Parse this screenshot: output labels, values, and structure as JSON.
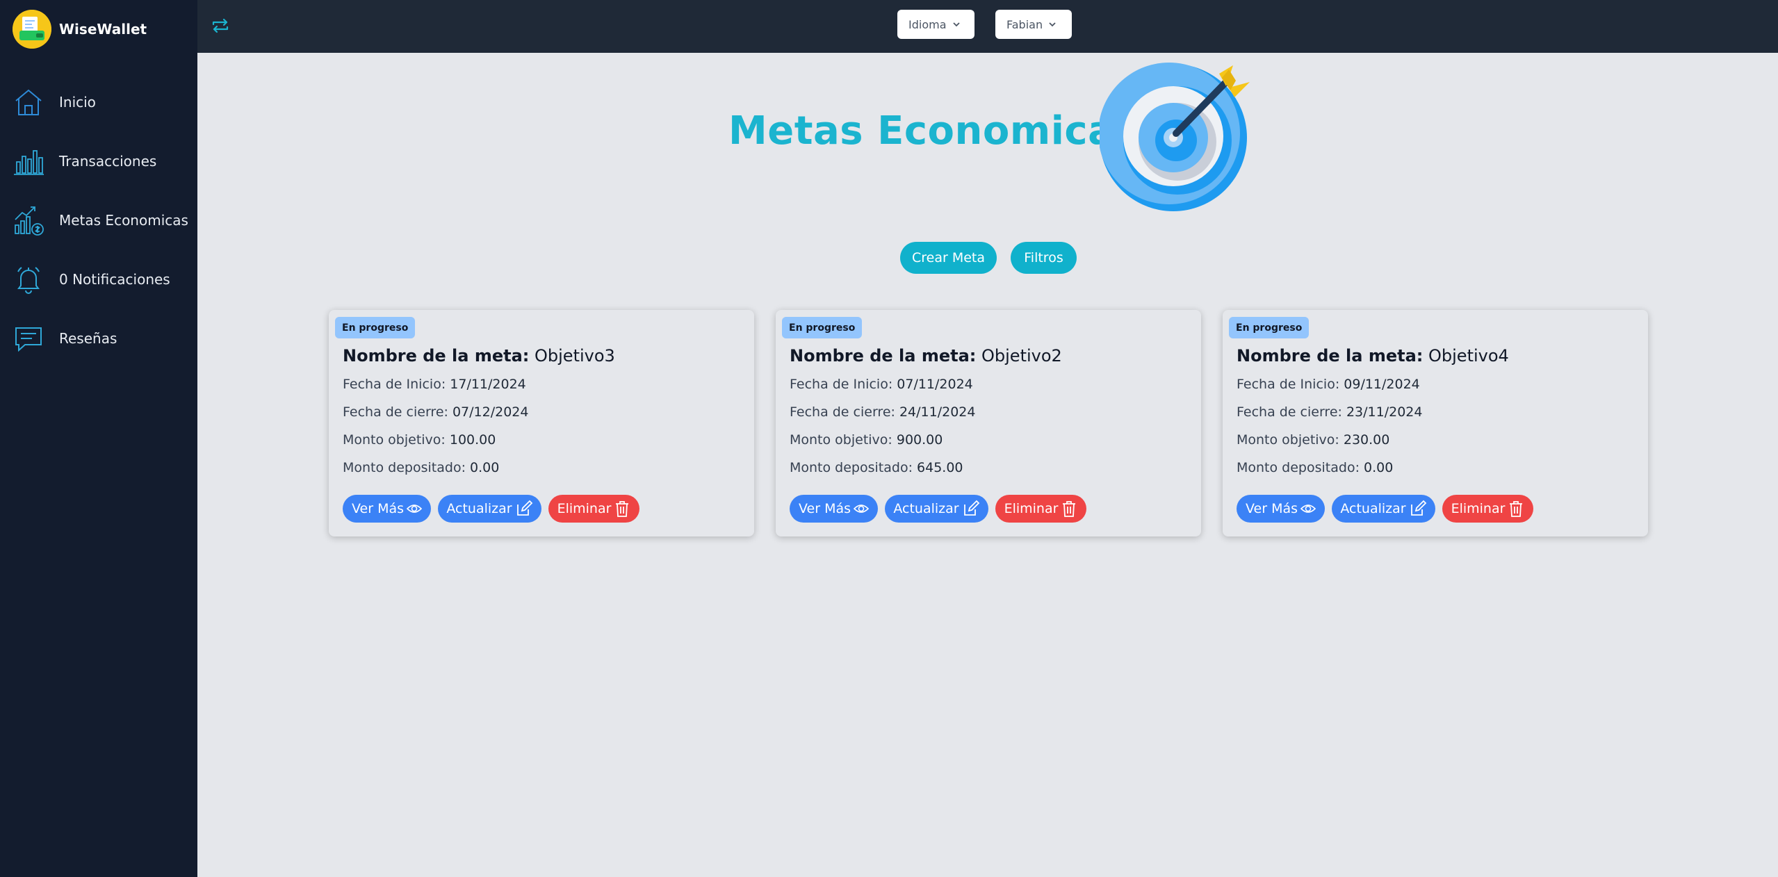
{
  "brand": {
    "name": "WiseWallet"
  },
  "sidebar": {
    "items": [
      {
        "label": "Inicio",
        "icon": "home-icon"
      },
      {
        "label": "Transacciones",
        "icon": "bar-chart-icon"
      },
      {
        "label": "Metas Economicas",
        "icon": "growth-money-icon"
      },
      {
        "label": "0 Notificaciones",
        "icon": "bell-icon"
      },
      {
        "label": "Reseñas",
        "icon": "chat-icon"
      }
    ]
  },
  "topbar": {
    "refresh_icon": "refresh-icon",
    "language_label": "Idioma",
    "user_label": "Fabian"
  },
  "page": {
    "title": "Metas Economicas"
  },
  "actions": {
    "create_label": "Crear Meta",
    "filters_label": "Filtros"
  },
  "labels": {
    "goal_name": "Nombre de la meta:",
    "start_date": "Fecha de Inicio:",
    "end_date": "Fecha de cierre:",
    "target_amount": "Monto objetivo:",
    "deposited_amount": "Monto depositado:",
    "view_more": "Ver Más",
    "update": "Actualizar",
    "delete": "Eliminar"
  },
  "goals": [
    {
      "status": "En progreso",
      "name": "Objetivo3",
      "start": "17/11/2024",
      "end": "07/12/2024",
      "target": "100.00",
      "deposited": "0.00"
    },
    {
      "status": "En progreso",
      "name": "Objetivo2",
      "start": "07/11/2024",
      "end": "24/11/2024",
      "target": "900.00",
      "deposited": "645.00"
    },
    {
      "status": "En progreso",
      "name": "Objetivo4",
      "start": "09/11/2024",
      "end": "23/11/2024",
      "target": "230.00",
      "deposited": "0.00"
    }
  ],
  "colors": {
    "sidebar_bg": "#131c2e",
    "topbar_bg": "#1f2937",
    "accent": "#10b1cc",
    "primary_button": "#3b82f6",
    "danger_button": "#ef4444",
    "badge": "#93c5fd"
  }
}
